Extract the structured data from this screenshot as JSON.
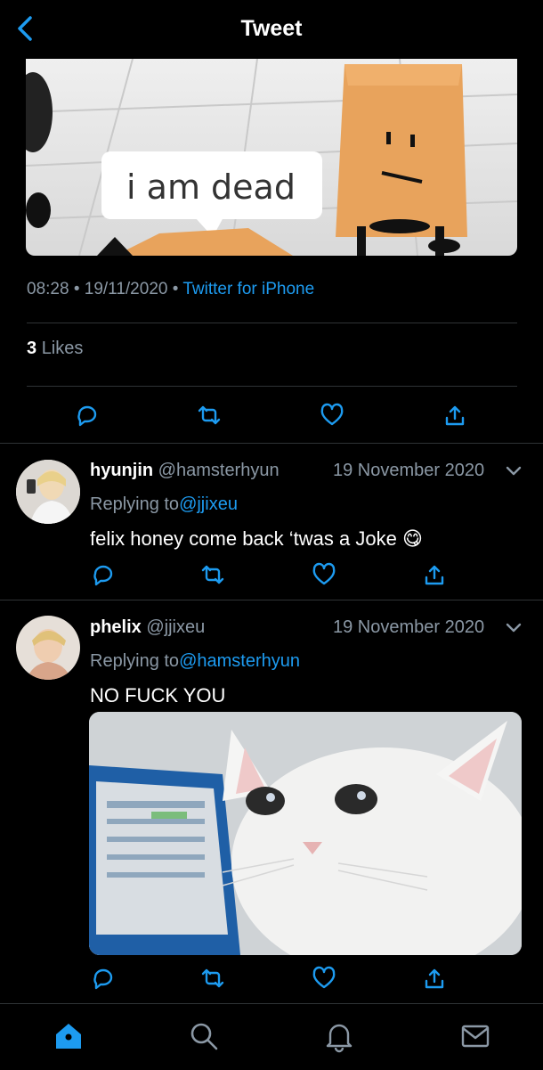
{
  "header": {
    "title": "Tweet",
    "back_icon": "chevron-left-icon"
  },
  "main_tweet": {
    "image": {
      "caption_text": "i am dead"
    },
    "time": "08:28",
    "date": "19/11/2020",
    "source": "Twitter for iPhone",
    "separator": "•",
    "likes_count": "3",
    "likes_label": "Likes",
    "actions": [
      "reply-icon",
      "retweet-icon",
      "like-icon",
      "share-icon"
    ]
  },
  "replies": [
    {
      "display_name": "hyunjin",
      "handle": "@hamsterhyun",
      "date": "19 November 2020",
      "replying_prefix": "Replying to",
      "replying_to": "@jjixeu",
      "text": "felix honey come back ‘twas a Joke",
      "emoji": "😋"
    },
    {
      "display_name": "phelix",
      "handle": "@jjixeu",
      "date": "19 November 2020",
      "replying_prefix": "Replying to",
      "replying_to": "@hamsterhyun",
      "text": "NO FUCK YOU"
    }
  ],
  "tabbar": {
    "items": [
      "home-icon",
      "search-icon",
      "notifications-icon",
      "messages-icon"
    ],
    "active": "home-icon"
  },
  "colors": {
    "accent": "#1d9bf0",
    "muted": "#8b98a5",
    "background": "#000000",
    "divider": "#2f3336"
  }
}
